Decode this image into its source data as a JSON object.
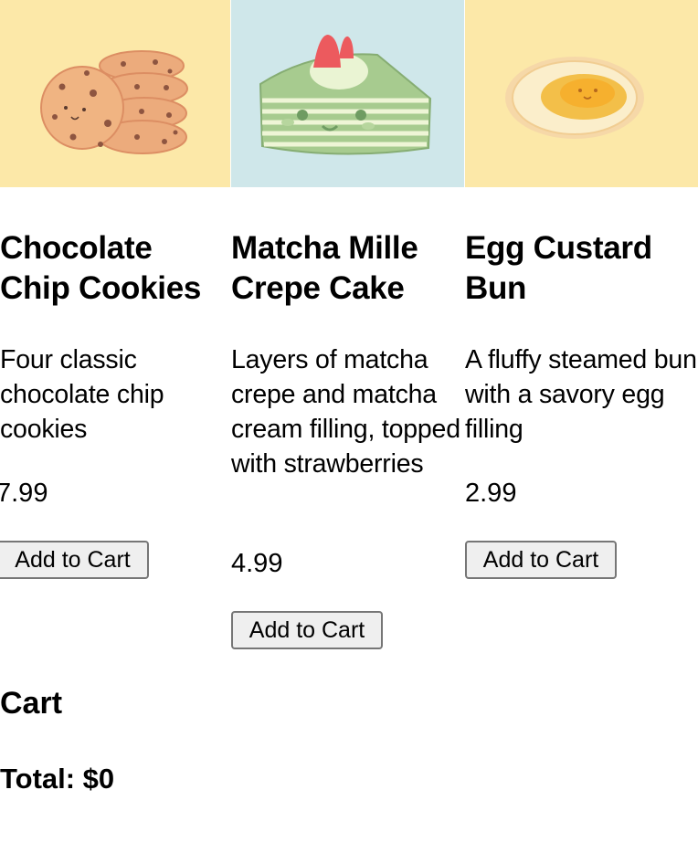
{
  "products": [
    {
      "image": "chocolate-chip-cookies-illustration",
      "image_bg": "#fce8a8",
      "name": "Chocolate Chip Cookies",
      "description": "Four classic chocolate chip cookies",
      "price": "7.99",
      "button": "Add to Cart"
    },
    {
      "image": "matcha-mille-crepe-cake-illustration",
      "image_bg": "#cfe7ea",
      "name": "Matcha Mille Crepe Cake",
      "description": "Layers of matcha crepe and matcha cream filling, topped with strawberries",
      "price": "4.99",
      "button": "Add to Cart"
    },
    {
      "image": "egg-custard-bun-illustration",
      "image_bg": "#fce8a8",
      "name": "Egg Custard Bun",
      "description": "A fluffy steamed bun with a savory egg filling",
      "price": "2.99",
      "button": "Add to Cart"
    }
  ],
  "cart": {
    "title": "Cart",
    "total": "Total: $0"
  }
}
